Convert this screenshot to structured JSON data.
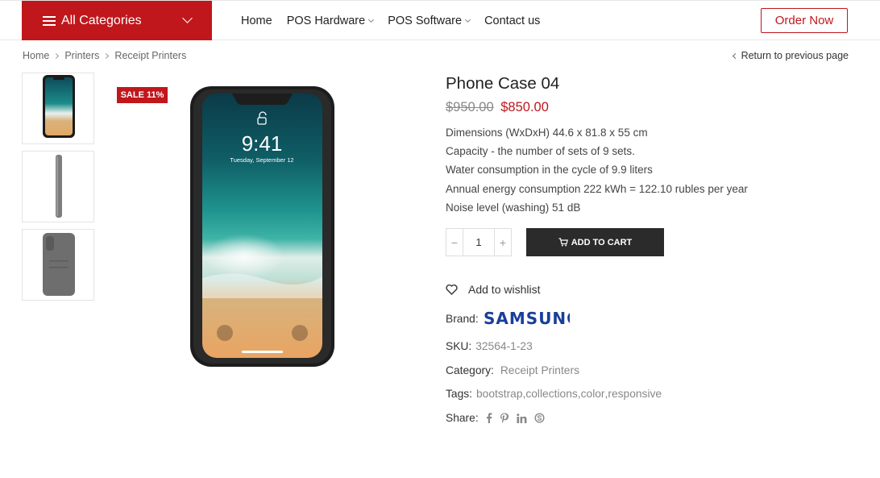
{
  "header": {
    "categories_label": "All Categories",
    "nav": [
      "Home",
      "POS Hardware",
      "POS Software",
      "Contact us"
    ],
    "order_label": "Order Now",
    "accent": "#c0171c"
  },
  "breadcrumb": [
    "Home",
    "Printers",
    "Receipt Printers"
  ],
  "back_link": "Return to previous page",
  "gallery": {
    "sale_badge": "SALE 11%",
    "phone_time": "9:41",
    "phone_date": "Tuesday, September 12"
  },
  "product": {
    "title": "Phone Case 04",
    "old_price": "$950.00",
    "new_price": "$850.00",
    "specs": [
      "Dimensions (WxDxH) 44.6 x 81.8 x 55 cm",
      "Capacity - the number of sets of 9 sets.",
      "Water consumption in the cycle of 9.9 liters",
      "Annual energy consumption 222 kWh = 122.10 rubles per year",
      "Noise level (washing) 51 dB"
    ],
    "qty": "1",
    "add_to_cart": "ADD TO CART",
    "wishlist": "Add to wishlist",
    "brand_label": "Brand:",
    "brand_name": "SAMSUNG",
    "sku_label": "SKU:",
    "sku": "32564-1-23",
    "category_label": "Category:",
    "category": "Receipt Printers",
    "tags_label": "Tags:",
    "tags": [
      "bootstrap",
      "collections",
      "color",
      "responsive"
    ],
    "share_label": "Share:",
    "share_icons": [
      "facebook-icon",
      "pinterest-icon",
      "linkedin-icon",
      "skype-icon"
    ]
  }
}
